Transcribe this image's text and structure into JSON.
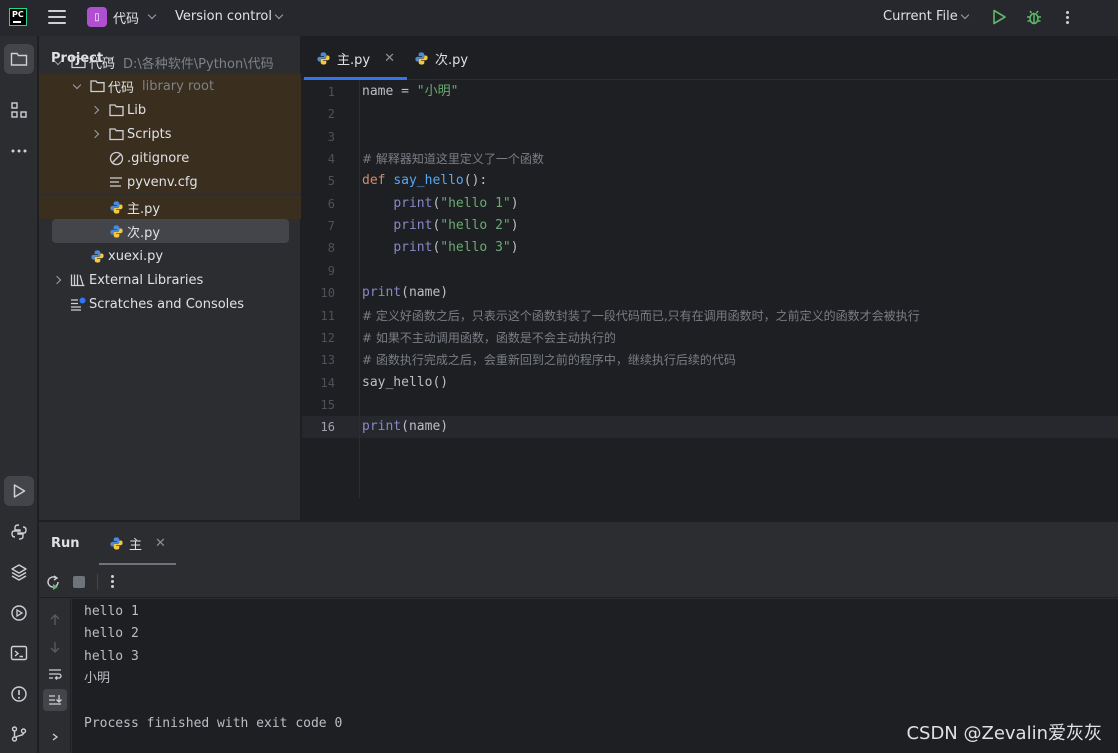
{
  "title_bar": {
    "project_badge": "▯",
    "project_name": "代码",
    "vcs_label": "Version control",
    "run_config": "Current File"
  },
  "project_panel": {
    "header": "Project",
    "tree": [
      {
        "label": "代码",
        "hint": "D:\\各种软件\\Python\\代码",
        "depth": 0,
        "arrow": "down",
        "icon": "folder-icon"
      },
      {
        "label": "代码",
        "hint": "library root",
        "depth": 1,
        "arrow": "down",
        "icon": "folder-icon"
      },
      {
        "label": "Lib",
        "hint": "",
        "depth": 2,
        "arrow": "right",
        "icon": "folder-icon"
      },
      {
        "label": "Scripts",
        "hint": "",
        "depth": 2,
        "arrow": "right",
        "icon": "folder-icon"
      },
      {
        "label": ".gitignore",
        "hint": "",
        "depth": 2,
        "arrow": "none",
        "icon": "ignore-file-icon"
      },
      {
        "label": "pyvenv.cfg",
        "hint": "",
        "depth": 2,
        "arrow": "none",
        "icon": "config-file-icon"
      },
      {
        "label": "主.py",
        "hint": "",
        "depth": 2,
        "arrow": "none",
        "icon": "python-file-icon"
      },
      {
        "label": "次.py",
        "hint": "",
        "depth": 2,
        "arrow": "none",
        "icon": "python-file-icon"
      },
      {
        "label": "xuexi.py",
        "hint": "",
        "depth": 1,
        "arrow": "none",
        "icon": "python-file-icon"
      },
      {
        "label": "External Libraries",
        "hint": "",
        "depth": 0,
        "arrow": "right",
        "icon": "library-icon"
      },
      {
        "label": "Scratches and Consoles",
        "hint": "",
        "depth": 0,
        "arrow": "none",
        "icon": "scratches-icon"
      }
    ]
  },
  "editor": {
    "tabs": [
      {
        "label": "主.py",
        "active": true
      },
      {
        "label": "次.py",
        "active": false
      }
    ],
    "current_line": 16,
    "lines": [
      [
        {
          "t": "name = ",
          "c": "plain"
        },
        {
          "t": "\"小明\"",
          "c": "str"
        }
      ],
      [],
      [],
      [
        {
          "t": "# 解释器知道这里定义了一个函数",
          "c": "cm"
        }
      ],
      [
        {
          "t": "def ",
          "c": "kw"
        },
        {
          "t": "say_hello",
          "c": "fn"
        },
        {
          "t": "():",
          "c": "plain"
        }
      ],
      [
        {
          "t": "    ",
          "c": "plain"
        },
        {
          "t": "print",
          "c": "builtin"
        },
        {
          "t": "(",
          "c": "plain"
        },
        {
          "t": "\"hello 1\"",
          "c": "str"
        },
        {
          "t": ")",
          "c": "plain"
        }
      ],
      [
        {
          "t": "    ",
          "c": "plain"
        },
        {
          "t": "print",
          "c": "builtin"
        },
        {
          "t": "(",
          "c": "plain"
        },
        {
          "t": "\"hello 2\"",
          "c": "str"
        },
        {
          "t": ")",
          "c": "plain"
        }
      ],
      [
        {
          "t": "    ",
          "c": "plain"
        },
        {
          "t": "print",
          "c": "builtin"
        },
        {
          "t": "(",
          "c": "plain"
        },
        {
          "t": "\"hello 3\"",
          "c": "str"
        },
        {
          "t": ")",
          "c": "plain"
        }
      ],
      [],
      [
        {
          "t": "print",
          "c": "builtin"
        },
        {
          "t": "(name)",
          "c": "plain"
        }
      ],
      [
        {
          "t": "# 定义好函数之后，只表示这个函数封装了一段代码而已,只有在调用函数时，之前定义的函数才会被执行",
          "c": "cm"
        }
      ],
      [
        {
          "t": "# 如果不主动调用函数，函数是不会主动执行的",
          "c": "cm"
        }
      ],
      [
        {
          "t": "# 函数执行完成之后，会重新回到之前的程序中，继续执行后续的代码",
          "c": "cm"
        }
      ],
      [
        {
          "t": "say_hello()",
          "c": "plain"
        }
      ],
      [],
      [
        {
          "t": "print",
          "c": "builtin"
        },
        {
          "t": "(name)",
          "c": "plain"
        }
      ]
    ]
  },
  "run_panel": {
    "title": "Run",
    "tab_label": "主",
    "output": [
      "hello 1",
      "hello 2",
      "hello 3",
      "小明",
      "",
      "Process finished with exit code 0"
    ]
  },
  "watermark": "CSDN @Zevalin爱灰灰"
}
